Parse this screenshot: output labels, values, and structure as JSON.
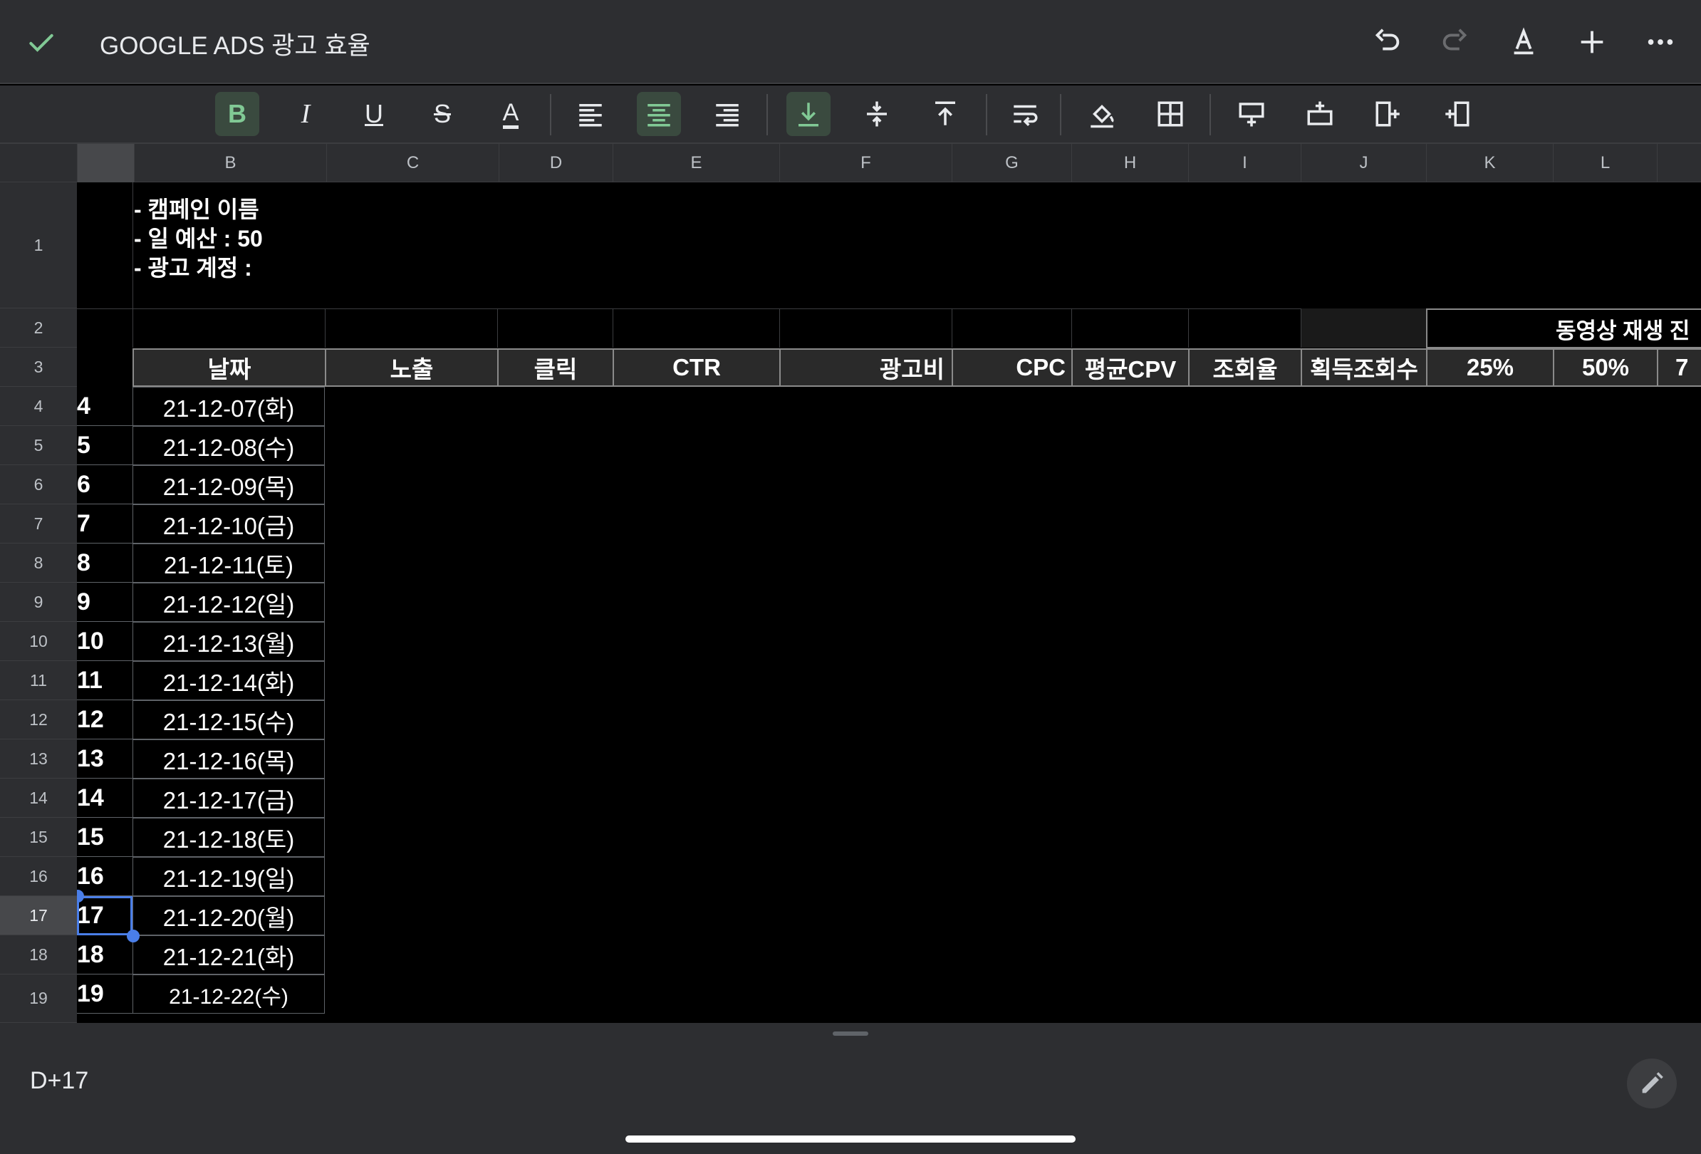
{
  "header": {
    "title": "GOOGLE ADS 광고 효율",
    "icons": [
      "check-icon",
      "undo-icon",
      "redo-icon",
      "text-format-icon",
      "add-icon",
      "more-icon"
    ]
  },
  "toolbar": {
    "tools": [
      "bold",
      "italic",
      "underline",
      "strikethrough",
      "text-color",
      "align-left",
      "align-center",
      "align-right",
      "valign-bottom",
      "valign-middle",
      "valign-top",
      "wrap",
      "fill-color",
      "borders",
      "insert-row-above",
      "insert-row-below",
      "insert-col-left",
      "insert-col-right"
    ],
    "bold_label": "B",
    "italic_label": "I",
    "underline_label": "U",
    "strike_label": "S",
    "textcolor_label": "A",
    "active": [
      "bold",
      "align-center",
      "valign-bottom"
    ]
  },
  "columns": [
    "B",
    "C",
    "D",
    "E",
    "F",
    "G",
    "H",
    "I",
    "J",
    "K",
    "L"
  ],
  "rows": [
    "1",
    "2",
    "3",
    "4",
    "5",
    "6",
    "7",
    "8",
    "9",
    "10",
    "11",
    "12",
    "13",
    "14",
    "15",
    "16",
    "17",
    "18",
    "19"
  ],
  "sheet": {
    "info_lines": [
      "- 캠페인 이름",
      "- 일 예산 : 50",
      "- 광고 계정 :"
    ],
    "group_header": "동영상 재생 진",
    "headers": [
      "날짜",
      "노출",
      "클릭",
      "CTR",
      "광고비",
      "CPC",
      "평균CPV",
      "조회율",
      "획득조회수",
      "25%",
      "50%",
      "7"
    ],
    "col_a_values": [
      "4",
      "5",
      "6",
      "7",
      "8",
      "9",
      "10",
      "11",
      "12",
      "13",
      "14",
      "15",
      "16",
      "17",
      "18",
      "19"
    ],
    "dates": [
      "21-12-07(화)",
      "21-12-08(수)",
      "21-12-09(목)",
      "21-12-10(금)",
      "21-12-11(토)",
      "21-12-12(일)",
      "21-12-13(월)",
      "21-12-14(화)",
      "21-12-15(수)",
      "21-12-16(목)",
      "21-12-17(금)",
      "21-12-18(토)",
      "21-12-19(일)",
      "21-12-20(월)",
      "21-12-21(화)",
      "21-12-22(수)"
    ],
    "selected_row": "17"
  },
  "formula_bar": {
    "value": "D+17"
  },
  "colors": {
    "background": "#000000",
    "chrome": "#2d2e31",
    "accent_green": "#81c995",
    "selection_blue": "#4a7ee8"
  }
}
